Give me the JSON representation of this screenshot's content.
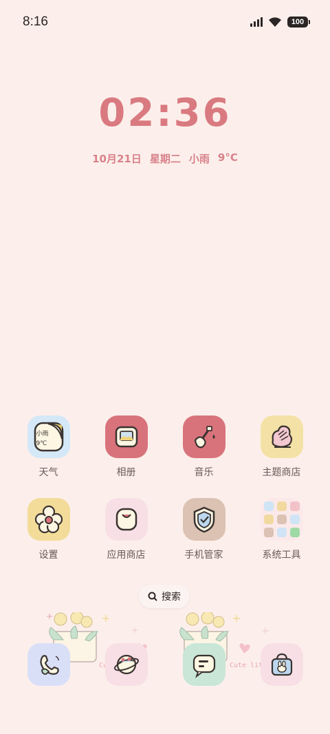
{
  "status_bar": {
    "time": "8:16",
    "battery": "100"
  },
  "lockscreen": {
    "clock": "02:36",
    "date": "10月21日",
    "weekday": "星期二",
    "weather": "小雨",
    "temperature": "9°C"
  },
  "apps": [
    {
      "label": "天气",
      "icon": "weather-icon",
      "widget_text": "小雨",
      "widget_temp": "9℃"
    },
    {
      "label": "相册",
      "icon": "gallery-icon"
    },
    {
      "label": "音乐",
      "icon": "music-guitar-icon"
    },
    {
      "label": "主题商店",
      "icon": "theme-store-icon"
    },
    {
      "label": "设置",
      "icon": "flower-settings-icon"
    },
    {
      "label": "应用商店",
      "icon": "app-store-icon"
    },
    {
      "label": "手机管家",
      "icon": "shield-icon"
    },
    {
      "label": "系统工具",
      "icon": "folder-icon"
    }
  ],
  "search": {
    "label": "搜索"
  },
  "decoration": {
    "text1": "Cute flower",
    "text2": "Cute litt"
  },
  "dock": [
    {
      "icon": "phone-icon"
    },
    {
      "icon": "planet-browser-icon"
    },
    {
      "icon": "messages-icon"
    },
    {
      "icon": "bunny-bag-icon"
    }
  ],
  "colors": {
    "background": "#fcefeb",
    "accent": "#d97a80"
  }
}
